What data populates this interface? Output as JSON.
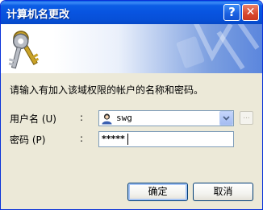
{
  "window": {
    "title": "计算机名更改",
    "help_label": "?",
    "close_label": "✕"
  },
  "banner": {
    "icon": "keys-icon"
  },
  "prompt": "请输入有加入该域权限的帐户的名称和密码。",
  "username": {
    "label": "用户名 (U)",
    "colon": ":",
    "value": "swg",
    "icon": "user-icon",
    "browse_label": "..."
  },
  "password": {
    "label": "密码 (P)",
    "colon": ":",
    "value": "*****"
  },
  "buttons": {
    "ok": "确定",
    "cancel": "取消"
  },
  "colors": {
    "titlebar": "#0854e0",
    "dialog_bg": "#ece9d8",
    "close_button": "#d9462c",
    "field_border": "#7f9db9"
  }
}
